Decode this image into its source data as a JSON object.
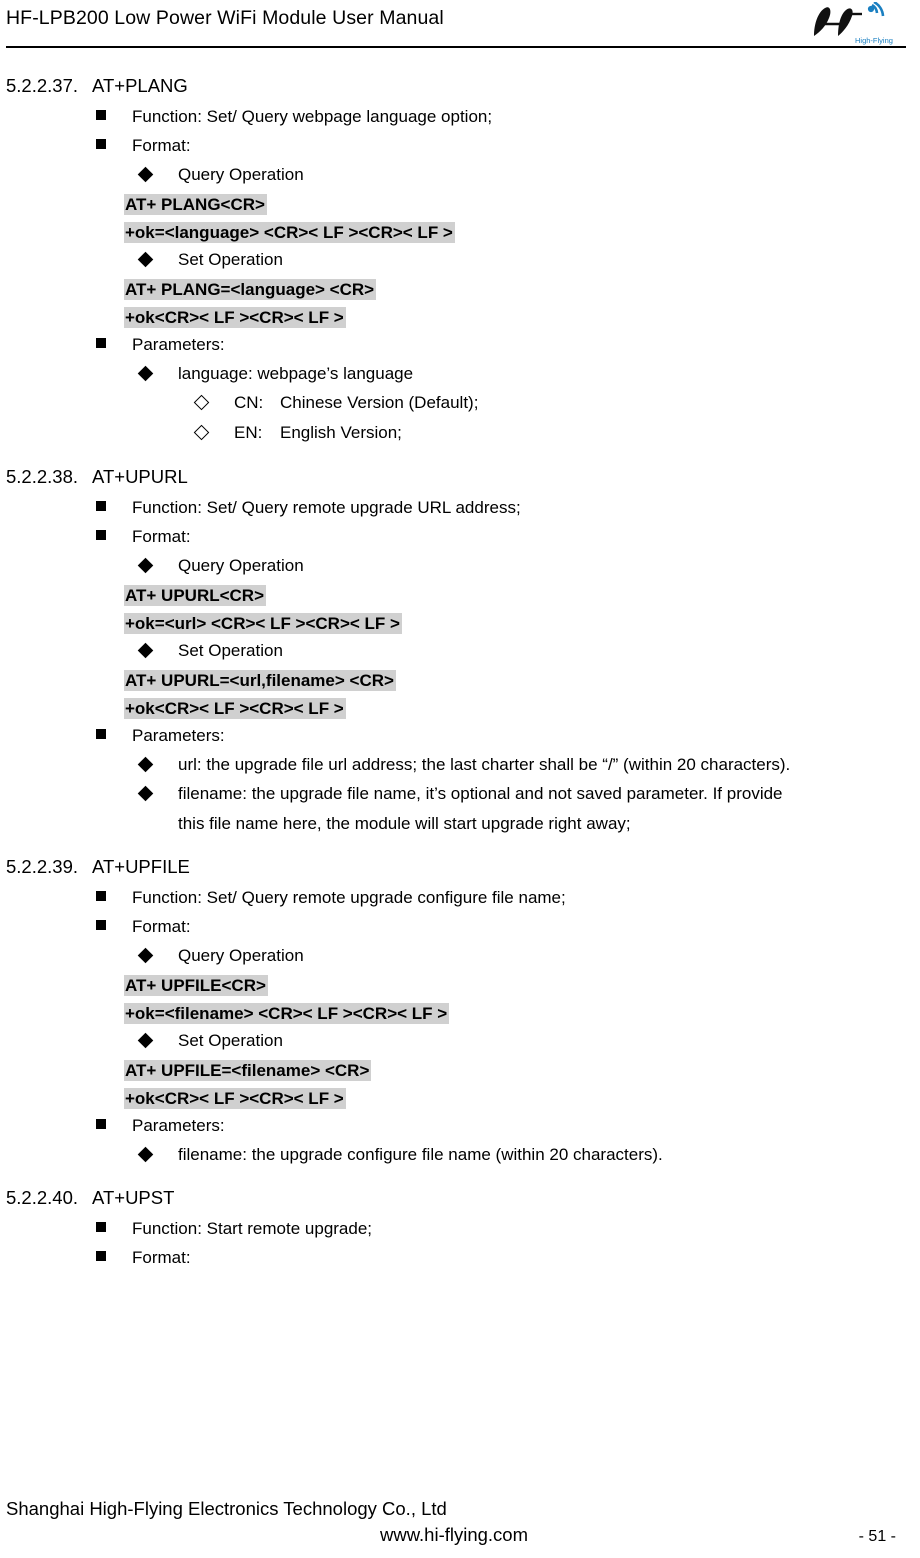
{
  "header": {
    "title": "HF-LPB200 Low Power WiFi Module User Manual",
    "logo_alt": "hi-flying-logo",
    "logo_text": "Hf",
    "logo_sub": "High-Flying"
  },
  "sections": [
    {
      "number": "5.2.2.37.",
      "title": "AT+PLANG",
      "function": "Function: Set/ Query webpage language option;",
      "format_label": "Format:",
      "query_label": "Query Operation",
      "query_cmd": "AT+ PLANG<CR>",
      "query_resp": "+ok=<language> <CR>< LF ><CR>< LF >",
      "set_label": "Set Operation",
      "set_cmd": "AT+ PLANG=<language> <CR>",
      "set_resp": "+ok<CR>< LF ><CR>< LF >",
      "params_label": "Parameters:",
      "params": [
        {
          "text": "language: webpage’s language",
          "subs": [
            {
              "key": "CN:",
              "val": "Chinese Version (Default);"
            },
            {
              "key": "EN:",
              "val": "English Version;"
            }
          ]
        }
      ]
    },
    {
      "number": "5.2.2.38.",
      "title": "AT+UPURL",
      "function": "Function: Set/ Query remote upgrade URL address;",
      "format_label": "Format:",
      "query_label": "Query Operation",
      "query_cmd": "AT+ UPURL<CR>",
      "query_resp": "+ok=<url> <CR>< LF ><CR>< LF >",
      "set_label": "Set Operation",
      "set_cmd": "AT+ UPURL=<url,filename> <CR>",
      "set_resp": "+ok<CR>< LF ><CR>< LF >",
      "params_label": "Parameters:",
      "params": [
        {
          "text": "url: the upgrade file url address; the last charter shall be “/” (within 20 characters).",
          "subs": []
        },
        {
          "text": "filename: the upgrade file name, it’s optional and not saved parameter. If provide",
          "cont": "this file name here, the module will start upgrade right away;",
          "subs": []
        }
      ]
    },
    {
      "number": "5.2.2.39.",
      "title": "AT+UPFILE",
      "function": "Function: Set/ Query remote upgrade configure file name;",
      "format_label": "Format:",
      "query_label": "Query Operation",
      "query_cmd": "AT+ UPFILE<CR>",
      "query_resp": "+ok=<filename> <CR>< LF ><CR>< LF >",
      "set_label": "Set Operation",
      "set_cmd": "AT+ UPFILE=<filename> <CR>",
      "set_resp": "+ok<CR>< LF ><CR>< LF >",
      "params_label": "Parameters:",
      "params": [
        {
          "text": "filename: the upgrade configure file name (within 20 characters).",
          "subs": []
        }
      ]
    },
    {
      "number": "5.2.2.40.",
      "title": "AT+UPST",
      "function": "Function: Start remote upgrade;",
      "format_label": "Format:"
    }
  ],
  "footer": {
    "company": "Shanghai High-Flying Electronics Technology Co., Ltd",
    "website": "www.hi-flying.com",
    "page": "- 51 -"
  }
}
